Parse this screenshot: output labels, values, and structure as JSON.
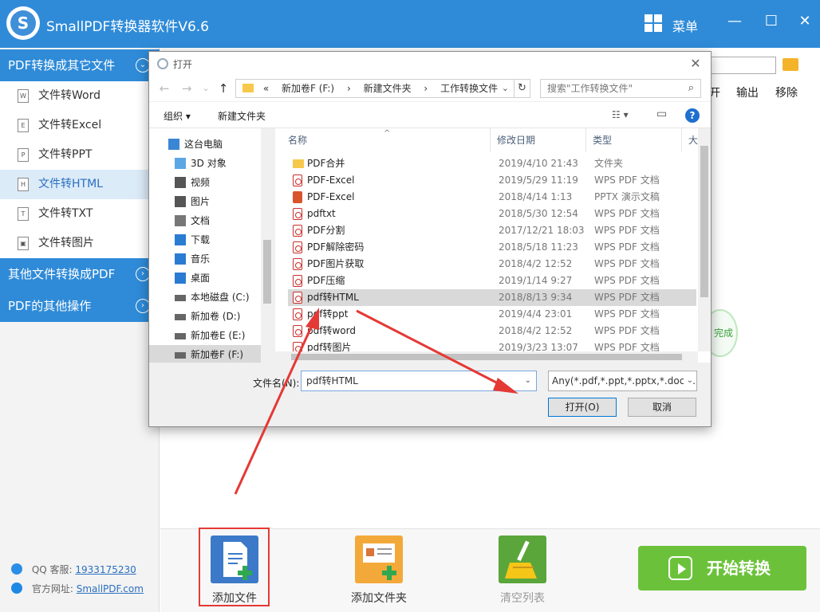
{
  "app": {
    "title": "SmallPDF转换器软件V6.6",
    "logo_letter": "S",
    "menu_label": "菜单",
    "minimize_glyph": "—",
    "maximize_glyph": "☐",
    "close_glyph": "✕"
  },
  "sidebar": {
    "section1_title": "PDF转换成其它文件",
    "section1_glyph": "⌄",
    "items": [
      {
        "label": "文件转Word",
        "icon": "W"
      },
      {
        "label": "文件转Excel",
        "icon": "E"
      },
      {
        "label": "文件转PPT",
        "icon": "P"
      },
      {
        "label": "文件转HTML",
        "icon": "H"
      },
      {
        "label": "文件转TXT",
        "icon": "T"
      },
      {
        "label": "文件转图片",
        "icon": "▣"
      }
    ],
    "active_index": 3,
    "section2_title": "其他文件转换成PDF",
    "section3_title": "PDF的其他操作",
    "collapsed_glyph": "›",
    "qq_label": "QQ 客服:",
    "qq_number": "1933175230",
    "site_label": "官方网址:",
    "site_url": "SmallPDF.com"
  },
  "background": {
    "col_open_partial": "开",
    "col_output": "输出",
    "col_remove": "移除",
    "status_done": "完成"
  },
  "bottombar": {
    "add_file": "添加文件",
    "add_folder": "添加文件夹",
    "clear_list": "清空列表",
    "start": "开始转换"
  },
  "dialog": {
    "title": "打开",
    "close_glyph": "✕",
    "back_glyph": "←",
    "forward_glyph": "→",
    "recent_glyph": "⌄",
    "up_glyph": "↑",
    "breadcrumb": [
      "«",
      "新加卷F (F:)",
      "›",
      "新建文件夹",
      "›",
      "工作转换文件"
    ],
    "address_dropdown": "⌄",
    "refresh_glyph": "↻",
    "search_placeholder": "搜索\"工作转换文件\"",
    "search_glyph": "⌕",
    "organize": "组织 ▾",
    "new_folder": "新建文件夹",
    "view_glyph": "☷ ▾",
    "pane_glyph": "▭",
    "help_glyph": "?",
    "nav_items": [
      {
        "label": "这台电脑",
        "icon": "pc"
      },
      {
        "label": "3D 对象",
        "icon": "cube"
      },
      {
        "label": "视频",
        "icon": "video"
      },
      {
        "label": "图片",
        "icon": "picture"
      },
      {
        "label": "文档",
        "icon": "document"
      },
      {
        "label": "下载",
        "icon": "download"
      },
      {
        "label": "音乐",
        "icon": "music"
      },
      {
        "label": "桌面",
        "icon": "desktop"
      },
      {
        "label": "本地磁盘 (C:)",
        "icon": "drive"
      },
      {
        "label": "新加卷 (D:)",
        "icon": "drive"
      },
      {
        "label": "新加卷E (E:)",
        "icon": "drive"
      },
      {
        "label": "新加卷F (F:)",
        "icon": "drive"
      }
    ],
    "nav_selected_index": 11,
    "columns": {
      "name": "名称",
      "modified": "修改日期",
      "type": "类型",
      "size": "大"
    },
    "sort_glyph": "^",
    "files": [
      {
        "name": "PDF合并",
        "date": "2019/4/10 21:43",
        "type": "文件夹",
        "kind": "folder"
      },
      {
        "name": "PDF-Excel",
        "date": "2019/5/29 11:19",
        "type": "WPS PDF 文档",
        "kind": "pdf"
      },
      {
        "name": "PDF-Excel",
        "date": "2018/4/14 1:13",
        "type": "PPTX 演示文稿",
        "kind": "pptx"
      },
      {
        "name": "pdftxt",
        "date": "2018/5/30 12:54",
        "type": "WPS PDF 文档",
        "kind": "pdf"
      },
      {
        "name": "PDF分割",
        "date": "2017/12/21 18:03",
        "type": "WPS PDF 文档",
        "kind": "pdf"
      },
      {
        "name": "PDF解除密码",
        "date": "2018/5/18 11:23",
        "type": "WPS PDF 文档",
        "kind": "pdf"
      },
      {
        "name": "PDF图片获取",
        "date": "2018/4/2 12:52",
        "type": "WPS PDF 文档",
        "kind": "pdf"
      },
      {
        "name": "PDF压缩",
        "date": "2019/1/14 9:27",
        "type": "WPS PDF 文档",
        "kind": "pdf"
      },
      {
        "name": "pdf转HTML",
        "date": "2018/8/13 9:34",
        "type": "WPS PDF 文档",
        "kind": "pdf"
      },
      {
        "name": "pdf转ppt",
        "date": "2019/4/4 23:01",
        "type": "WPS PDF 文档",
        "kind": "pdf"
      },
      {
        "name": "pdf转word",
        "date": "2018/4/2 12:52",
        "type": "WPS PDF 文档",
        "kind": "pdf"
      },
      {
        "name": "pdf转图片",
        "date": "2019/3/23 13:07",
        "type": "WPS PDF 文档",
        "kind": "pdf"
      }
    ],
    "selected_file_index": 8,
    "filename_label": "文件名(N):",
    "filename_value": "pdf转HTML",
    "filename_dropdown": "⌄",
    "filetype_value": "Any(*.pdf,*.ppt,*.pptx,*.doc,*.",
    "filetype_dropdown": "⌄",
    "open_button": "打开(O)",
    "cancel_button": "取消"
  },
  "colors": {
    "brand_blue": "#2f8bd8",
    "start_green": "#6bc23a",
    "annotation_red": "#e53935"
  }
}
